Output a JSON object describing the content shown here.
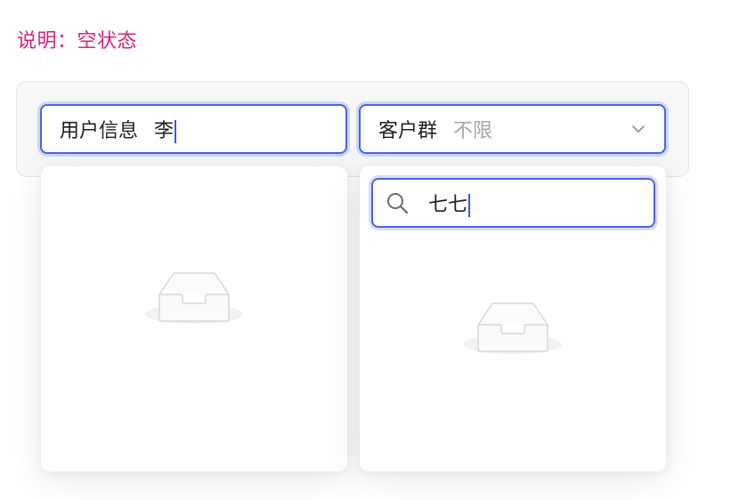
{
  "note": {
    "text": "说明：空状态"
  },
  "filters": {
    "user_info": {
      "label": "用户信息",
      "value": "李"
    },
    "customer_group": {
      "label": "客户群",
      "placeholder": "不限",
      "icon": "chevron-down-icon"
    }
  },
  "dropdown_user": {
    "state": "empty",
    "icon": "empty-inbox-icon"
  },
  "dropdown_group": {
    "search_value": "七七",
    "search_icon": "search-icon",
    "state": "empty",
    "icon": "empty-inbox-icon"
  },
  "colors": {
    "note": "#d4237a",
    "focus_border": "#4a63e6",
    "placeholder": "#a6a6ad"
  }
}
